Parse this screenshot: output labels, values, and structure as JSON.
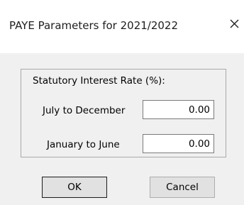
{
  "window": {
    "title": "PAYE Parameters for 2021/2022",
    "close_icon": "close-icon"
  },
  "group": {
    "label": "Statutory Interest Rate (%):",
    "fields": [
      {
        "label": "July to December",
        "value": "0.00"
      },
      {
        "label": "January to June",
        "value": "0.00"
      }
    ]
  },
  "buttons": {
    "ok_label": "OK",
    "cancel_label": "Cancel"
  }
}
